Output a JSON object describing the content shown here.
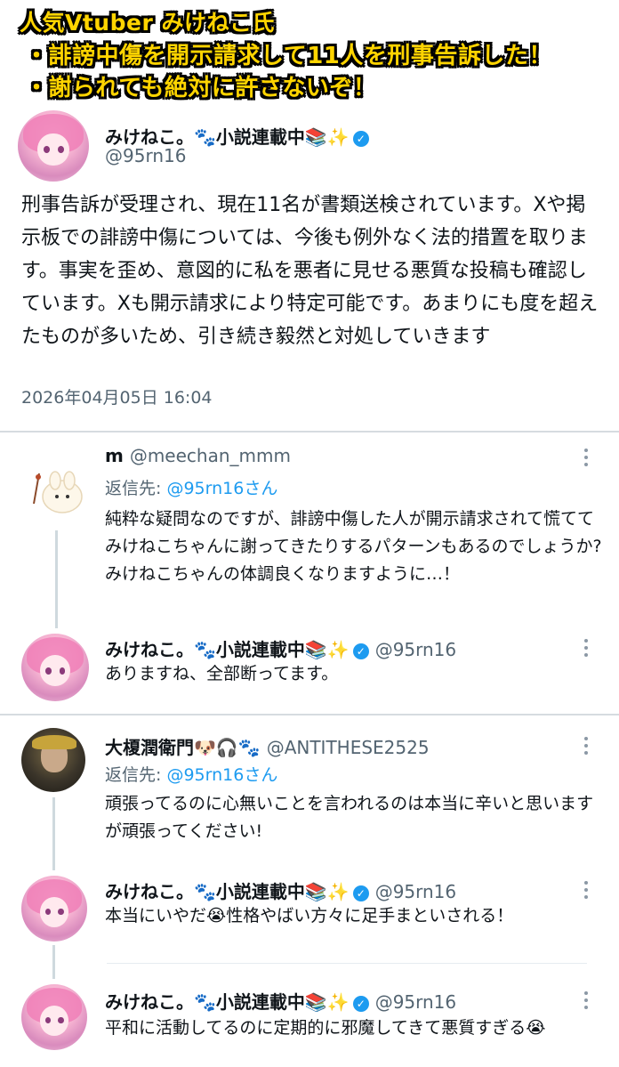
{
  "banner": {
    "line1": "人気Vtuber みけねこ氏",
    "line2": "・誹謗中傷を開示請求して11人を刑事告訴した！",
    "line3": "・謝られても絶対に許さないぞ！"
  },
  "main_post": {
    "display_name": "みけねこ。🐾小説連載中📚✨",
    "handle": "@95rn16",
    "text": "刑事告訴が受理され、現在11名が書類送検されています。Xや掲示板での誹謗中傷については、今後も例外なく法的措置を取ります。事実を歪め、意図的に私を悪者に見せる悪質な投稿も確認しています。Xも開示請求により特定可能です。あまりにも度を超えたものが多いため、引き続き毅然と対処していきます",
    "timestamp": "2026年04月05日 16:04"
  },
  "verified_mark": "✓",
  "replies": [
    {
      "display_name": "m",
      "handle": "@meechan_mmm",
      "reply_to_label": "返信先: ",
      "reply_to_target": "@95rn16さん",
      "text": "純粋な疑問なのですが、誹謗中傷した人が開示請求されて慌ててみけねこちゃんに謝ってきたりするパターンもあるのでしょうか?\nみけねこちゃんの体調良くなりますように…！"
    },
    {
      "display_name": "みけねこ。🐾小説連載中📚✨",
      "handle": "@95rn16",
      "text": "ありますね、全部断ってます。"
    },
    {
      "display_name": "大榎潤衛門🐶🎧🐾",
      "handle": "@ANTITHESE2525",
      "reply_to_label": "返信先: ",
      "reply_to_target": "@95rn16さん",
      "text": "頑張ってるのに心無いことを言われるのは本当に辛いと思いますが頑張ってください!"
    },
    {
      "display_name": "みけねこ。🐾小説連載中📚✨",
      "handle": "@95rn16",
      "text": "本当にいやだ😭性格やばい方々に足手まといされる！"
    },
    {
      "display_name": "みけねこ。🐾小説連載中📚✨",
      "handle": "@95rn16",
      "text": "平和に活動してるのに定期的に邪魔してきて悪質すぎる😭"
    }
  ],
  "colors": {
    "banner_text": "#ffd400",
    "banner_outline": "#000000",
    "handle_gray": "#536471",
    "mention_blue": "#1d9bf0",
    "verified_blue": "#1d9bf0"
  }
}
